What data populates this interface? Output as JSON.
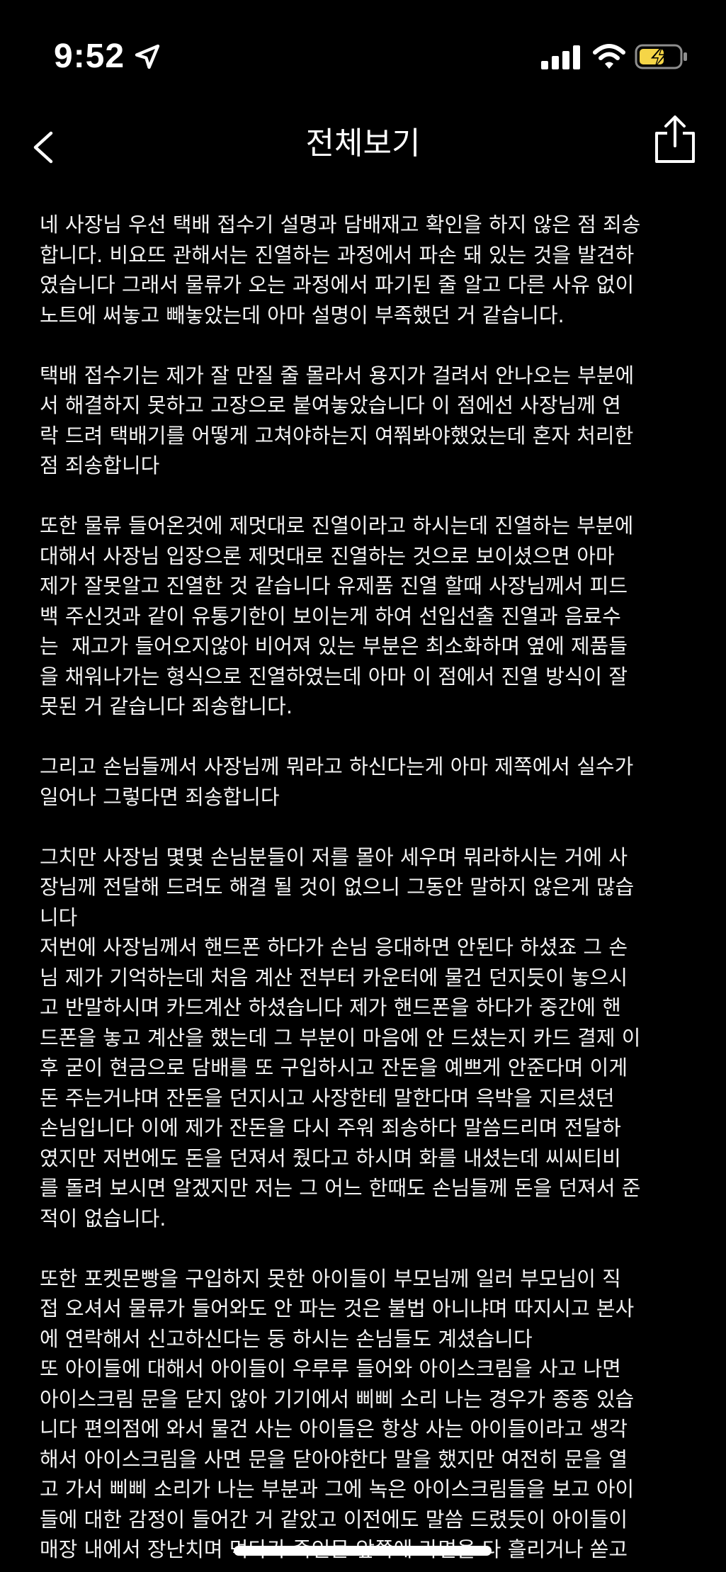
{
  "status_bar": {
    "time": "9:52",
    "icons": [
      "location-arrow-icon",
      "cellular-signal-icon",
      "wifi-icon",
      "battery-charging-icon"
    ],
    "battery_color": "#f5d547"
  },
  "nav": {
    "title": "전체보기",
    "back_icon": "chevron-left-icon",
    "share_icon": "share-icon"
  },
  "content": {
    "paragraphs": [
      "네 사장님 우선 택배 접수기 설명과 담배재고 확인을 하지 않은 점 죄송\n합니다. 비요뜨 관해서는 진열하는 과정에서 파손 돼 있는 것을 발견하\n였습니다 그래서 물류가 오는 과정에서 파기된 줄 알고 다른 사유 없이\n노트에 써놓고 빼놓았는데 아마 설명이 부족했던 거 같습니다.",
      "택배 접수기는 제가 잘 만질 줄 몰라서 용지가 걸려서 안나오는 부분에\n서 해결하지 못하고 고장으로 붙여놓았습니다 이 점에선 사장님께 연\n락 드려 택배기를 어떻게 고쳐야하는지 여쭤봐야했었는데 혼자 처리한\n점 죄송합니다",
      "또한 물류 들어온것에 제멋대로 진열이라고 하시는데 진열하는 부분에\n대해서 사장님 입장으론 제멋대로 진열하는 것으로 보이셨으면 아마\n제가 잘못알고 진열한 것 같습니다 유제품 진열 할때 사장님께서 피드\n백 주신것과 같이 유통기한이 보이는게 하여 선입선출 진열과 음료수\n는  재고가 들어오지않아 비어져 있는 부분은 최소화하며 옆에 제품들\n을 채워나가는 형식으로 진열하였는데 아마 이 점에서 진열 방식이 잘\n못된 거 같습니다 죄송합니다.",
      "그리고 손님들께서 사장님께 뭐라고 하신다는게 아마 제쪽에서 실수가\n일어나 그렇다면 죄송합니다",
      "그치만 사장님 몇몇 손님분들이 저를 몰아 세우며 뭐라하시는 거에 사\n장님께 전달해 드려도 해결 될 것이 없으니 그동안 말하지 않은게 많습\n니다\n저번에 사장님께서 핸드폰 하다가 손님 응대하면 안된다 하셨죠 그 손\n님 제가 기억하는데 처음 계산 전부터 카운터에 물건 던지듯이 놓으시\n고 반말하시며 카드계산 하셨습니다 제가 핸드폰을 하다가 중간에 핸\n드폰을 놓고 계산을 했는데 그 부분이 마음에 안 드셨는지 카드 결제 이\n후 굳이 현금으로 담배를 또 구입하시고 잔돈을 예쁘게 안준다며 이게\n돈 주는거냐며 잔돈을 던지시고 사장한테 말한다며 윽박을 지르셨던\n손님입니다 이에 제가 잔돈을 다시 주워 죄송하다 말씀드리며 전달하\n였지만 저번에도 돈을 던져서 줬다고 하시며 화를 내셨는데 씨씨티비\n를 돌려 보시면 알겠지만 저는 그 어느 한때도 손님들께 돈을 던져서 준\n적이 없습니다.",
      "또한 포켓몬빵을 구입하지 못한 아이들이 부모님께 일러 부모님이 직\n접 오셔서 물류가 들어와도 안 파는 것은 불법 아니냐며 따지시고 본사\n에 연락해서 신고하신다는 둥 하시는 손님들도 계셨습니다\n또 아이들에 대해서 아이들이 우루루 들어와 아이스크림을 사고 나면\n아이스크림 문을 닫지 않아 기기에서 삐삐 소리 나는 경우가 종종 있습\n니다 편의점에 와서 물건 사는 아이들은 항상 사는 아이들이라고 생각\n해서 아이스크림을 사면 문을 닫아야한다 말을 했지만 여전히 문을 열\n고 가서 삐삐 소리가 나는 부분과 그에 녹은 아이스크림들을 보고 아이\n들에 대한 감정이 들어간 거 같았고 이전에도 말씀 드렸듯이 아이들이\n매장 내에서 장난치며 먹다가 죽인문 앞쪽에 라면을 다 흘리거나 쏟고"
    ]
  }
}
